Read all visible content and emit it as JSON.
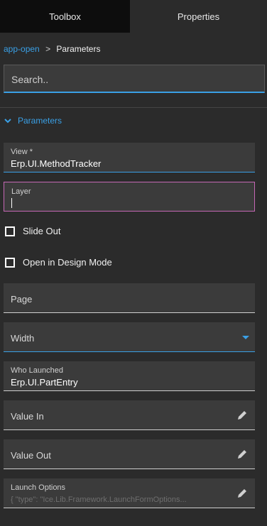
{
  "tabs": {
    "toolbox": "Toolbox",
    "properties": "Properties"
  },
  "breadcrumb": {
    "link": "app-open",
    "separator": ">",
    "current": "Parameters"
  },
  "search": {
    "placeholder": "Search.."
  },
  "section": {
    "title": "Parameters"
  },
  "fields": {
    "view": {
      "label": "View *",
      "value": "Erp.UI.MethodTracker"
    },
    "layer": {
      "label": "Layer",
      "value": ""
    },
    "slide_out": {
      "label": "Slide Out",
      "checked": false
    },
    "open_in_design_mode": {
      "label": "Open in Design Mode",
      "checked": false
    },
    "page": {
      "placeholder": "Page"
    },
    "width": {
      "placeholder": "Width"
    },
    "who_launched": {
      "label": "Who Launched",
      "value": "Erp.UI.PartEntry"
    },
    "value_in": {
      "placeholder": "Value In"
    },
    "value_out": {
      "placeholder": "Value Out"
    },
    "launch_options": {
      "label": "Launch Options",
      "value": "{ \"type\": \"Ice.Lib.Framework.LaunchFormOptions..."
    }
  },
  "colors": {
    "accent": "#3aa0e6",
    "focus_border": "#c567b5",
    "background": "#2b2b2b",
    "field_bg": "#3b3b3b"
  },
  "icons": {
    "expand": "chevron-down-icon",
    "edit": "pencil-icon",
    "dropdown": "caret-down-icon"
  }
}
